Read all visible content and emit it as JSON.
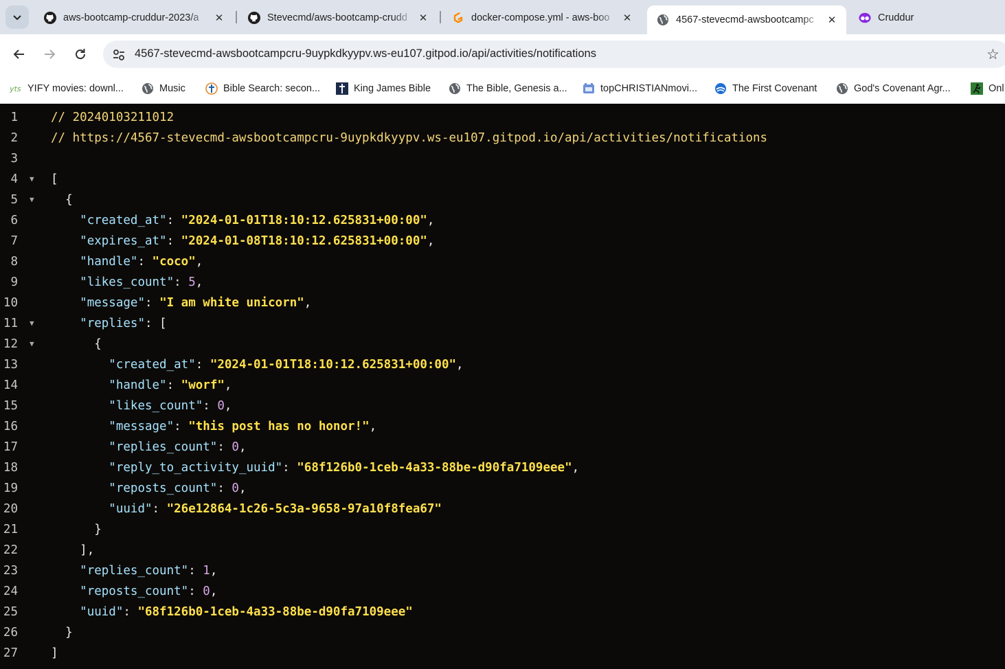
{
  "browser": {
    "tabs": [
      {
        "title": "aws-bootcamp-cruddur-2023/a",
        "icon": "github-icon",
        "active": false
      },
      {
        "title": "Stevecmd/aws-bootcamp-crudd",
        "icon": "github-icon",
        "active": false
      },
      {
        "title": "docker-compose.yml - aws-boo",
        "icon": "gitpod-icon",
        "active": false
      },
      {
        "title": "4567-stevecmd-awsbootcampc",
        "icon": "globe-icon",
        "active": true
      },
      {
        "title": "Cruddur",
        "icon": "cruddur-icon",
        "active": false
      }
    ],
    "tab_close_glyph": "✕",
    "url": "4567-stevecmd-awsbootcampcru-9uypkdkyypv.ws-eu107.gitpod.io/api/activities/notifications",
    "bookmarks": [
      {
        "label": "YIFY movies: downl...",
        "icon": "yts-icon"
      },
      {
        "label": "Music",
        "icon": "globe-icon"
      },
      {
        "label": "Bible Search: secon...",
        "icon": "cross-icon"
      },
      {
        "label": "King James Bible",
        "icon": "kjv-cross-icon"
      },
      {
        "label": "The Bible, Genesis a...",
        "icon": "globe-icon"
      },
      {
        "label": "topCHRISTIANmovi...",
        "icon": "film-icon"
      },
      {
        "label": "The First Covenant",
        "icon": "covenant-icon"
      },
      {
        "label": "God's Covenant Agr...",
        "icon": "globe-icon"
      },
      {
        "label": "Onl",
        "icon": "runner-icon"
      }
    ]
  },
  "viewer": {
    "lines": [
      {
        "n": "1",
        "fold": false,
        "indent": "",
        "tokens": [
          {
            "t": "// 20240103211012",
            "c": "cmt"
          }
        ]
      },
      {
        "n": "2",
        "fold": false,
        "indent": "",
        "tokens": [
          {
            "t": "// https://4567-stevecmd-awsbootcampcru-9uypkdkyypv.ws-eu107.gitpod.io/api/activities/notifications",
            "c": "cmt"
          }
        ]
      },
      {
        "n": "3",
        "fold": false,
        "indent": "",
        "tokens": []
      },
      {
        "n": "4",
        "fold": true,
        "indent": "",
        "tokens": [
          {
            "t": "[",
            "c": "pun"
          }
        ]
      },
      {
        "n": "5",
        "fold": true,
        "indent": "  ",
        "tokens": [
          {
            "t": "{",
            "c": "pun"
          }
        ]
      },
      {
        "n": "6",
        "fold": false,
        "indent": "    ",
        "tokens": [
          {
            "t": "\"created_at\"",
            "c": "key"
          },
          {
            "t": ": ",
            "c": "pun"
          },
          {
            "t": "\"2024-01-01T18:10:12.625831+00:00\"",
            "c": "str"
          },
          {
            "t": ",",
            "c": "pun"
          }
        ]
      },
      {
        "n": "7",
        "fold": false,
        "indent": "    ",
        "tokens": [
          {
            "t": "\"expires_at\"",
            "c": "key"
          },
          {
            "t": ": ",
            "c": "pun"
          },
          {
            "t": "\"2024-01-08T18:10:12.625831+00:00\"",
            "c": "str"
          },
          {
            "t": ",",
            "c": "pun"
          }
        ]
      },
      {
        "n": "8",
        "fold": false,
        "indent": "    ",
        "tokens": [
          {
            "t": "\"handle\"",
            "c": "key"
          },
          {
            "t": ": ",
            "c": "pun"
          },
          {
            "t": "\"coco\"",
            "c": "str"
          },
          {
            "t": ",",
            "c": "pun"
          }
        ]
      },
      {
        "n": "9",
        "fold": false,
        "indent": "    ",
        "tokens": [
          {
            "t": "\"likes_count\"",
            "c": "key"
          },
          {
            "t": ": ",
            "c": "pun"
          },
          {
            "t": "5",
            "c": "num"
          },
          {
            "t": ",",
            "c": "pun"
          }
        ]
      },
      {
        "n": "10",
        "fold": false,
        "indent": "    ",
        "tokens": [
          {
            "t": "\"message\"",
            "c": "key"
          },
          {
            "t": ": ",
            "c": "pun"
          },
          {
            "t": "\"I am white unicorn\"",
            "c": "str"
          },
          {
            "t": ",",
            "c": "pun"
          }
        ]
      },
      {
        "n": "11",
        "fold": true,
        "indent": "    ",
        "tokens": [
          {
            "t": "\"replies\"",
            "c": "key"
          },
          {
            "t": ": [",
            "c": "pun"
          }
        ]
      },
      {
        "n": "12",
        "fold": true,
        "indent": "      ",
        "tokens": [
          {
            "t": "{",
            "c": "pun"
          }
        ]
      },
      {
        "n": "13",
        "fold": false,
        "indent": "        ",
        "tokens": [
          {
            "t": "\"created_at\"",
            "c": "key"
          },
          {
            "t": ": ",
            "c": "pun"
          },
          {
            "t": "\"2024-01-01T18:10:12.625831+00:00\"",
            "c": "str"
          },
          {
            "t": ",",
            "c": "pun"
          }
        ]
      },
      {
        "n": "14",
        "fold": false,
        "indent": "        ",
        "tokens": [
          {
            "t": "\"handle\"",
            "c": "key"
          },
          {
            "t": ": ",
            "c": "pun"
          },
          {
            "t": "\"worf\"",
            "c": "str"
          },
          {
            "t": ",",
            "c": "pun"
          }
        ]
      },
      {
        "n": "15",
        "fold": false,
        "indent": "        ",
        "tokens": [
          {
            "t": "\"likes_count\"",
            "c": "key"
          },
          {
            "t": ": ",
            "c": "pun"
          },
          {
            "t": "0",
            "c": "num"
          },
          {
            "t": ",",
            "c": "pun"
          }
        ]
      },
      {
        "n": "16",
        "fold": false,
        "indent": "        ",
        "tokens": [
          {
            "t": "\"message\"",
            "c": "key"
          },
          {
            "t": ": ",
            "c": "pun"
          },
          {
            "t": "\"this post has no honor!\"",
            "c": "str"
          },
          {
            "t": ",",
            "c": "pun"
          }
        ]
      },
      {
        "n": "17",
        "fold": false,
        "indent": "        ",
        "tokens": [
          {
            "t": "\"replies_count\"",
            "c": "key"
          },
          {
            "t": ": ",
            "c": "pun"
          },
          {
            "t": "0",
            "c": "num"
          },
          {
            "t": ",",
            "c": "pun"
          }
        ]
      },
      {
        "n": "18",
        "fold": false,
        "indent": "        ",
        "tokens": [
          {
            "t": "\"reply_to_activity_uuid\"",
            "c": "key"
          },
          {
            "t": ": ",
            "c": "pun"
          },
          {
            "t": "\"68f126b0-1ceb-4a33-88be-d90fa7109eee\"",
            "c": "str"
          },
          {
            "t": ",",
            "c": "pun"
          }
        ]
      },
      {
        "n": "19",
        "fold": false,
        "indent": "        ",
        "tokens": [
          {
            "t": "\"reposts_count\"",
            "c": "key"
          },
          {
            "t": ": ",
            "c": "pun"
          },
          {
            "t": "0",
            "c": "num"
          },
          {
            "t": ",",
            "c": "pun"
          }
        ]
      },
      {
        "n": "20",
        "fold": false,
        "indent": "        ",
        "tokens": [
          {
            "t": "\"uuid\"",
            "c": "key"
          },
          {
            "t": ": ",
            "c": "pun"
          },
          {
            "t": "\"26e12864-1c26-5c3a-9658-97a10f8fea67\"",
            "c": "str"
          }
        ]
      },
      {
        "n": "21",
        "fold": false,
        "indent": "      ",
        "tokens": [
          {
            "t": "}",
            "c": "pun"
          }
        ]
      },
      {
        "n": "22",
        "fold": false,
        "indent": "    ",
        "tokens": [
          {
            "t": "],",
            "c": "pun"
          }
        ]
      },
      {
        "n": "23",
        "fold": false,
        "indent": "    ",
        "tokens": [
          {
            "t": "\"replies_count\"",
            "c": "key"
          },
          {
            "t": ": ",
            "c": "pun"
          },
          {
            "t": "1",
            "c": "num"
          },
          {
            "t": ",",
            "c": "pun"
          }
        ]
      },
      {
        "n": "24",
        "fold": false,
        "indent": "    ",
        "tokens": [
          {
            "t": "\"reposts_count\"",
            "c": "key"
          },
          {
            "t": ": ",
            "c": "pun"
          },
          {
            "t": "0",
            "c": "num"
          },
          {
            "t": ",",
            "c": "pun"
          }
        ]
      },
      {
        "n": "25",
        "fold": false,
        "indent": "    ",
        "tokens": [
          {
            "t": "\"uuid\"",
            "c": "key"
          },
          {
            "t": ": ",
            "c": "pun"
          },
          {
            "t": "\"68f126b0-1ceb-4a33-88be-d90fa7109eee\"",
            "c": "str"
          }
        ]
      },
      {
        "n": "26",
        "fold": false,
        "indent": "  ",
        "tokens": [
          {
            "t": "}",
            "c": "pun"
          }
        ]
      },
      {
        "n": "27",
        "fold": false,
        "indent": "",
        "tokens": [
          {
            "t": "]",
            "c": "pun"
          }
        ]
      }
    ]
  },
  "colors": {
    "viewer_bg": "#0c0a08",
    "comment": "#f3d77a",
    "key": "#a6e3ff",
    "string": "#ffe14d",
    "number": "#d7a7e6",
    "tabstrip_bg": "#dee3eb"
  }
}
